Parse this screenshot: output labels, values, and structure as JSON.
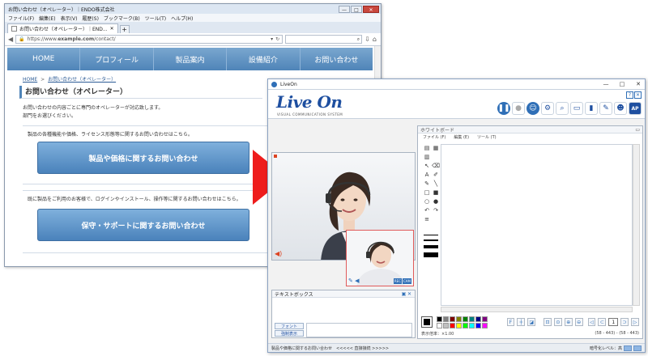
{
  "browser": {
    "window_title": "お問い合わせ（オペレーター）｜ENDO株式会社",
    "menu": [
      "ファイル(F)",
      "編集(E)",
      "表示(V)",
      "履歴(S)",
      "ブックマーク(B)",
      "ツール(T)",
      "ヘルプ(H)"
    ],
    "tab_label": "お問い合わせ（オペレーター）｜END...",
    "new_tab": "+",
    "url_prefix": "https://www.",
    "url_domain": "example.com",
    "url_path": "/contact/",
    "nav": [
      "HOME",
      "プロフィール",
      "製品案内",
      "設備紹介",
      "お問い合わせ"
    ],
    "breadcrumb": [
      "HOME",
      "お問い合わせ（オペレーター）"
    ],
    "breadcrumb_sep": ">",
    "page_heading": "お問い合わせ（オペレーター）",
    "intro_lines": [
      "お問い合わせの内容ごとに専門のオペレーターが対応致します。",
      "部門をお選びください。"
    ],
    "section1_text": "製品の各種機能や価格、ライセンス形態等に関するお問い合わせはこちら。",
    "section1_button": "製品や価格に関するお問い合わせ",
    "section2_text": "既に製品をご利用のお客様で、ログインやインストール、操作等に関するお問い合わせはこちら。",
    "section2_button": "保守・サポートに関するお問い合わせ",
    "win_min": "—",
    "win_max": "□",
    "win_close": "✕"
  },
  "liveon": {
    "window_title": "LiveOn",
    "logo": "Live On",
    "subtitle": "VISUAL COMMUNICATION SYSTEM",
    "help_q": "?",
    "help_x": "✕",
    "textbox_title": "テキストボックス",
    "font_btn": "フォント",
    "force_btn": "強制表示",
    "whiteboard_title": "ホワイトボード",
    "wb_menu": [
      "ファイル (F)",
      "編集 (E)",
      "ツール (T)"
    ],
    "page_number": "1",
    "zoom_label": "表示倍率：×1.00",
    "coords": "(58 - 443) - (58 - 443)",
    "status_left": "製品や価格に関するお問い合わせ　<<<<< 直接接続 >>>>>",
    "status_right": "暗号化レベル：高",
    "pip_tags": [
      "REC",
      "CAM"
    ]
  },
  "colors": {
    "nav_blue": "#4f84b8",
    "liveon_blue": "#1e4fa0",
    "arrow_red": "#ee1c1c"
  },
  "palette": [
    "#000000",
    "#808080",
    "#800000",
    "#808000",
    "#008000",
    "#008080",
    "#000080",
    "#800080",
    "#ffffff",
    "#c0c0c0",
    "#ff0000",
    "#ffff00",
    "#00ff00",
    "#00ffff",
    "#0000ff",
    "#ff00ff"
  ]
}
